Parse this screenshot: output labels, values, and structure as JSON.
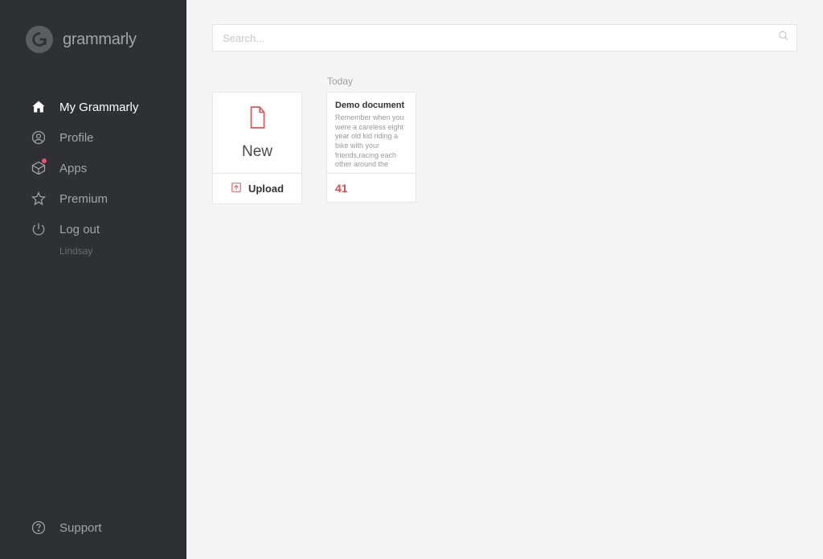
{
  "brand": {
    "name": "grammarly"
  },
  "sidebar": {
    "items": [
      {
        "label": "My Grammarly",
        "active": true
      },
      {
        "label": "Profile"
      },
      {
        "label": "Apps",
        "badge": true
      },
      {
        "label": "Premium"
      },
      {
        "label": "Log out"
      }
    ],
    "user": "Lindsay",
    "support": "Support"
  },
  "search": {
    "placeholder": "Search..."
  },
  "section": {
    "today_label": "Today"
  },
  "new_card": {
    "label": "New",
    "upload": "Upload"
  },
  "documents": [
    {
      "title": "Demo document",
      "preview": "Remember when you were a careless eight year old kid riding a bike with your friends,racing each other around the",
      "issues": "41"
    }
  ]
}
